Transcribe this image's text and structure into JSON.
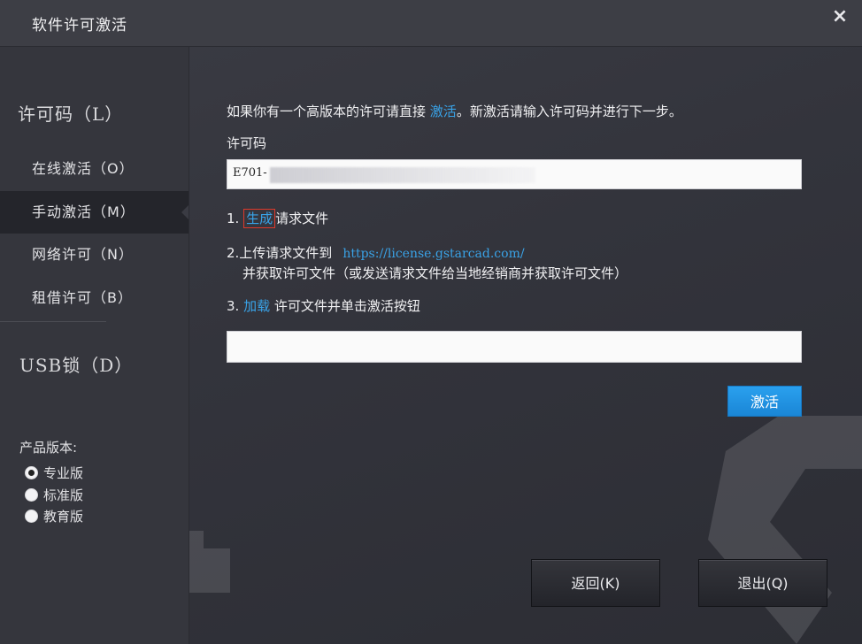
{
  "window": {
    "title": "软件许可激活",
    "close_icon": "×"
  },
  "sidebar": {
    "license_section": "许可码（L）",
    "items": [
      {
        "label": "在线激活（O）",
        "active": false
      },
      {
        "label": "手动激活（M）",
        "active": true
      },
      {
        "label": "网络许可（N）",
        "active": false
      },
      {
        "label": "租借许可（B）",
        "active": false
      }
    ],
    "usb_section": "USB锁（D）",
    "version_label": "产品版本:",
    "versions": [
      {
        "label": "专业版",
        "checked": true
      },
      {
        "label": "标准版",
        "checked": false
      },
      {
        "label": "教育版",
        "checked": false
      }
    ]
  },
  "main": {
    "intro_prefix": "如果你有一个高版本的许可请直接",
    "intro_link": "激活",
    "intro_suffix": "。新激活请输入许可码并进行下一步。",
    "license_key_label": "许可码",
    "license_key_value": "E701-",
    "step1_prefix": "1.",
    "step1_link": "生成",
    "step1_suffix": "请求文件",
    "step2_prefix": "2.上传请求文件到",
    "step2_url": "https://license.gstarcad.com/",
    "step2_line2": "并获取许可文件（或发送请求文件给当地经销商并获取许可文件）",
    "step3_prefix": "3.",
    "step3_link": "加载",
    "step3_suffix": "许可文件并单击激活按钮",
    "license_file_value": "",
    "activate_button": "激活"
  },
  "footer": {
    "back_button": "返回(K)",
    "exit_button": "退出(Q)"
  }
}
